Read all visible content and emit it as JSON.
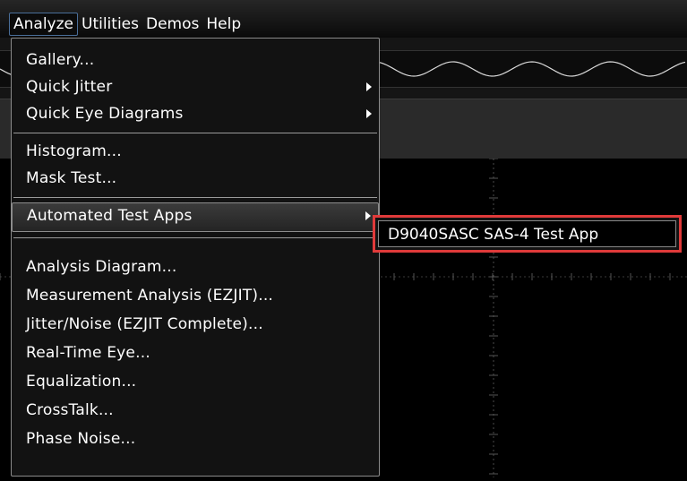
{
  "menubar": {
    "items": [
      {
        "label": "Analyze",
        "active": true
      },
      {
        "label": "Utilities",
        "active": false
      },
      {
        "label": "Demos",
        "active": false
      },
      {
        "label": "Help",
        "active": false
      }
    ]
  },
  "analyze_menu": {
    "items": [
      {
        "label": "Gallery...",
        "has_submenu": false
      },
      {
        "label": "Quick Jitter",
        "has_submenu": true
      },
      {
        "label": "Quick Eye Diagrams",
        "has_submenu": true
      },
      {
        "label": "Histogram...",
        "has_submenu": false
      },
      {
        "label": "Mask Test...",
        "has_submenu": false
      },
      {
        "label": "Automated Test Apps",
        "has_submenu": true,
        "highlighted": true
      },
      {
        "label": "Analysis Diagram...",
        "has_submenu": false
      },
      {
        "label": "Measurement Analysis (EZJIT)...",
        "has_submenu": false
      },
      {
        "label": "Jitter/Noise (EZJIT Complete)...",
        "has_submenu": false
      },
      {
        "label": "Real-Time Eye...",
        "has_submenu": false
      },
      {
        "label": "Equalization...",
        "has_submenu": false
      },
      {
        "label": "CrossTalk...",
        "has_submenu": false
      },
      {
        "label": "Phase Noise...",
        "has_submenu": false
      }
    ]
  },
  "submenu": {
    "items": [
      {
        "label": "D9040SASC SAS-4 Test App"
      }
    ]
  },
  "colors": {
    "callout_border": "#e03a3a",
    "menu_background": "#121212",
    "menu_text": "#ffffff",
    "menubar_active_border": "#4a6e99"
  }
}
